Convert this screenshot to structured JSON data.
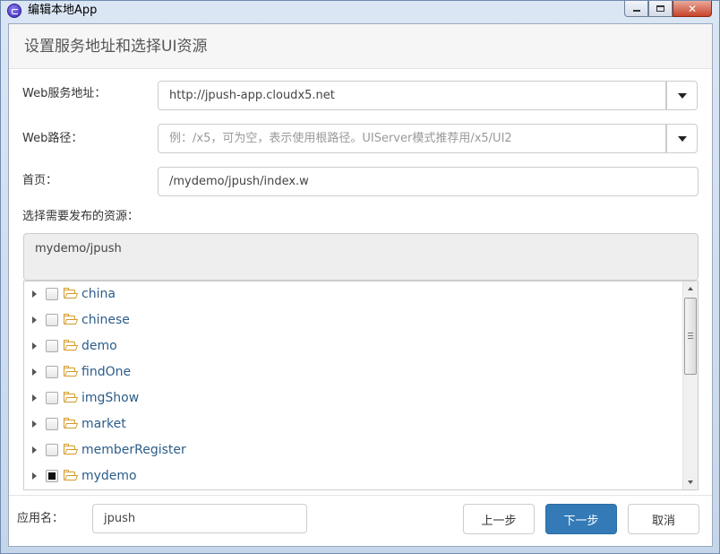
{
  "window": {
    "title": "编辑本地App",
    "close_glyph": "✕",
    "icons": {
      "app": "app-logo-icon",
      "minimize": "minimize-icon",
      "maximize": "maximize-icon",
      "close": "close-icon"
    }
  },
  "dialog": {
    "heading": "设置服务地址和选择UI资源"
  },
  "form": {
    "web_service": {
      "label": "Web服务地址：",
      "value": "http://jpush-app.cloudx5.net"
    },
    "web_path": {
      "label": "Web路径：",
      "value": "",
      "placeholder": "例：/x5，可为空，表示使用根路径。UIServer模式推荐用/x5/UI2"
    },
    "home_page": {
      "label": "首页：",
      "value": "/mydemo/jpush/index.w"
    },
    "resources_label": "选择需要发布的资源："
  },
  "selected_resources": "mydemo/jpush",
  "tree": {
    "items": [
      {
        "label": "china",
        "checked": "none"
      },
      {
        "label": "chinese",
        "checked": "none"
      },
      {
        "label": "demo",
        "checked": "none"
      },
      {
        "label": "findOne",
        "checked": "none"
      },
      {
        "label": "imgShow",
        "checked": "none"
      },
      {
        "label": "market",
        "checked": "none"
      },
      {
        "label": "memberRegister",
        "checked": "none"
      },
      {
        "label": "mydemo",
        "checked": "partial"
      }
    ],
    "scroll_fraction": 0.0
  },
  "footer": {
    "app_name_label": "应用名：",
    "app_name_value": "jpush",
    "prev_label": "上一步",
    "next_label": "下一步",
    "cancel_label": "取消"
  },
  "colors": {
    "primary": "#337ab7",
    "tree_text": "#2b5d8a",
    "folder": "#d39b2a"
  }
}
